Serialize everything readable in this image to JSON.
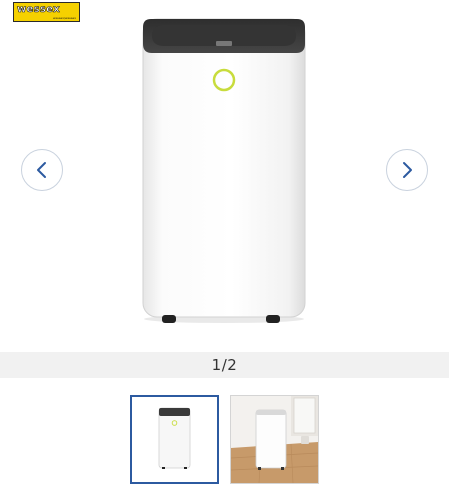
{
  "brand": {
    "logo_text": "wessex",
    "logo_subtext": "wessex/wessex",
    "logo_color": "#f5d100"
  },
  "gallery": {
    "counter": "1/2",
    "current_index": 1,
    "total": 2,
    "prev_icon": "chevron-left-icon",
    "next_icon": "chevron-right-icon",
    "accent_color": "#2c5aa0",
    "thumbnails": [
      {
        "name": "thumbnail-front-view",
        "selected": true
      },
      {
        "name": "thumbnail-room-view",
        "selected": false
      }
    ]
  },
  "product": {
    "body_color": "#ffffff",
    "top_color": "#3a3a3a",
    "ring_color": "#c8dc3c"
  }
}
